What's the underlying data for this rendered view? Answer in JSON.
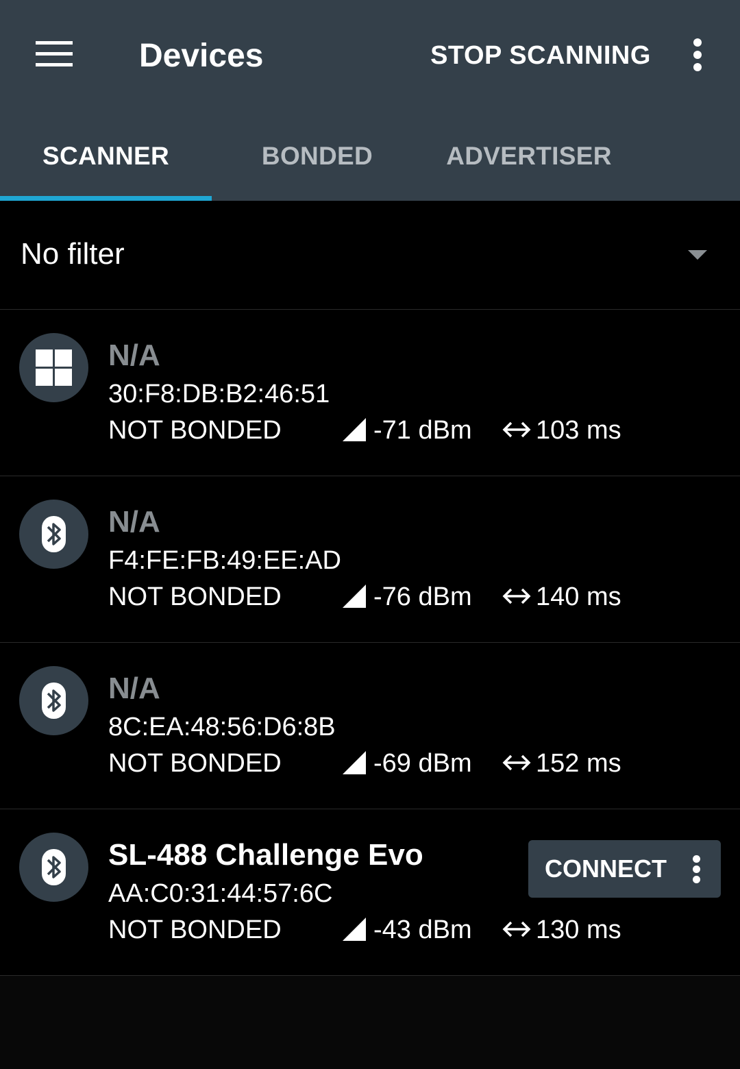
{
  "appbar": {
    "title": "Devices",
    "action_label": "STOP SCANNING",
    "menu_icon": "hamburger-menu-icon",
    "overflow_icon": "more-vertical-icon"
  },
  "tabs": [
    {
      "label": "SCANNER",
      "active": true
    },
    {
      "label": "BONDED",
      "active": false
    },
    {
      "label": "ADVERTISER",
      "active": false
    }
  ],
  "filter": {
    "label": "No filter",
    "icon": "dropdown-arrow-icon"
  },
  "devices": [
    {
      "name": "N/A",
      "address": "30:F8:DB:B2:46:51",
      "bond_state": "NOT BONDED",
      "rssi": "-71 dBm",
      "interval": "103 ms",
      "icon": "windows-icon",
      "connectable": false
    },
    {
      "name": "N/A",
      "address": "F4:FE:FB:49:EE:AD",
      "bond_state": "NOT BONDED",
      "rssi": "-76 dBm",
      "interval": "140 ms",
      "icon": "bluetooth-icon",
      "connectable": false
    },
    {
      "name": "N/A",
      "address": "8C:EA:48:56:D6:8B",
      "bond_state": "NOT BONDED",
      "rssi": "-69 dBm",
      "interval": "152 ms",
      "icon": "bluetooth-icon",
      "connectable": false
    },
    {
      "name": "SL-488 Challenge Evo",
      "address": "AA:C0:31:44:57:6C",
      "bond_state": "NOT BONDED",
      "rssi": "-43 dBm",
      "interval": "130 ms",
      "icon": "bluetooth-icon",
      "connectable": true,
      "connect_label": "CONNECT"
    }
  ],
  "colors": {
    "appbar": "#34404a",
    "background": "#000000",
    "tab_indicator": "#1fa6d3",
    "unnamed_device_text": "#888d91"
  }
}
